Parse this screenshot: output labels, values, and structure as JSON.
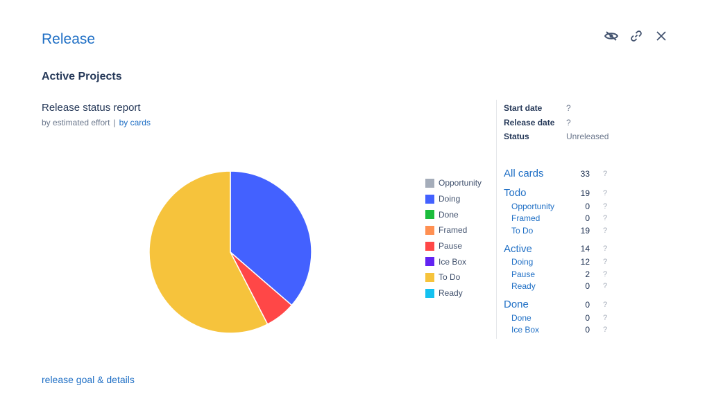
{
  "header": {
    "title": "Release",
    "icons": [
      "eye-hidden-icon",
      "link-icon",
      "close-icon"
    ]
  },
  "board": {
    "name": "Active Projects"
  },
  "report": {
    "title": "Release status report",
    "by_effort": "by estimated effort",
    "separator": "|",
    "by_cards": "by cards"
  },
  "chart_data": {
    "type": "pie",
    "title": "",
    "slices": [
      {
        "label": "Opportunity",
        "value": 0,
        "color": "#a5adba"
      },
      {
        "label": "Doing",
        "value": 12,
        "color": "#4361ff"
      },
      {
        "label": "Done",
        "value": 0,
        "color": "#1bbc3c"
      },
      {
        "label": "Framed",
        "value": 0,
        "color": "#ff9052"
      },
      {
        "label": "Pause",
        "value": 2,
        "color": "#ff4747"
      },
      {
        "label": "Ice Box",
        "value": 0,
        "color": "#6223f2"
      },
      {
        "label": "To Do",
        "value": 19,
        "color": "#f6c33c"
      },
      {
        "label": "Ready",
        "value": 0,
        "color": "#14c1f0"
      }
    ],
    "legend_position": "right"
  },
  "meta": {
    "start_date_label": "Start date",
    "start_date_value": "?",
    "release_date_label": "Release date",
    "release_date_value": "?",
    "status_label": "Status",
    "status_value": "Unreleased"
  },
  "counts": {
    "help": "?",
    "all": {
      "label": "All cards",
      "count": "33"
    },
    "todo": {
      "label": "Todo",
      "count": "19",
      "items": [
        {
          "label": "Opportunity",
          "count": "0"
        },
        {
          "label": "Framed",
          "count": "0"
        },
        {
          "label": "To Do",
          "count": "19"
        }
      ]
    },
    "active": {
      "label": "Active",
      "count": "14",
      "items": [
        {
          "label": "Doing",
          "count": "12"
        },
        {
          "label": "Pause",
          "count": "2"
        },
        {
          "label": "Ready",
          "count": "0"
        }
      ]
    },
    "done": {
      "label": "Done",
      "count": "0",
      "items": [
        {
          "label": "Done",
          "count": "0"
        },
        {
          "label": "Ice Box",
          "count": "0"
        }
      ]
    }
  },
  "footer": {
    "link": "release goal & details"
  }
}
